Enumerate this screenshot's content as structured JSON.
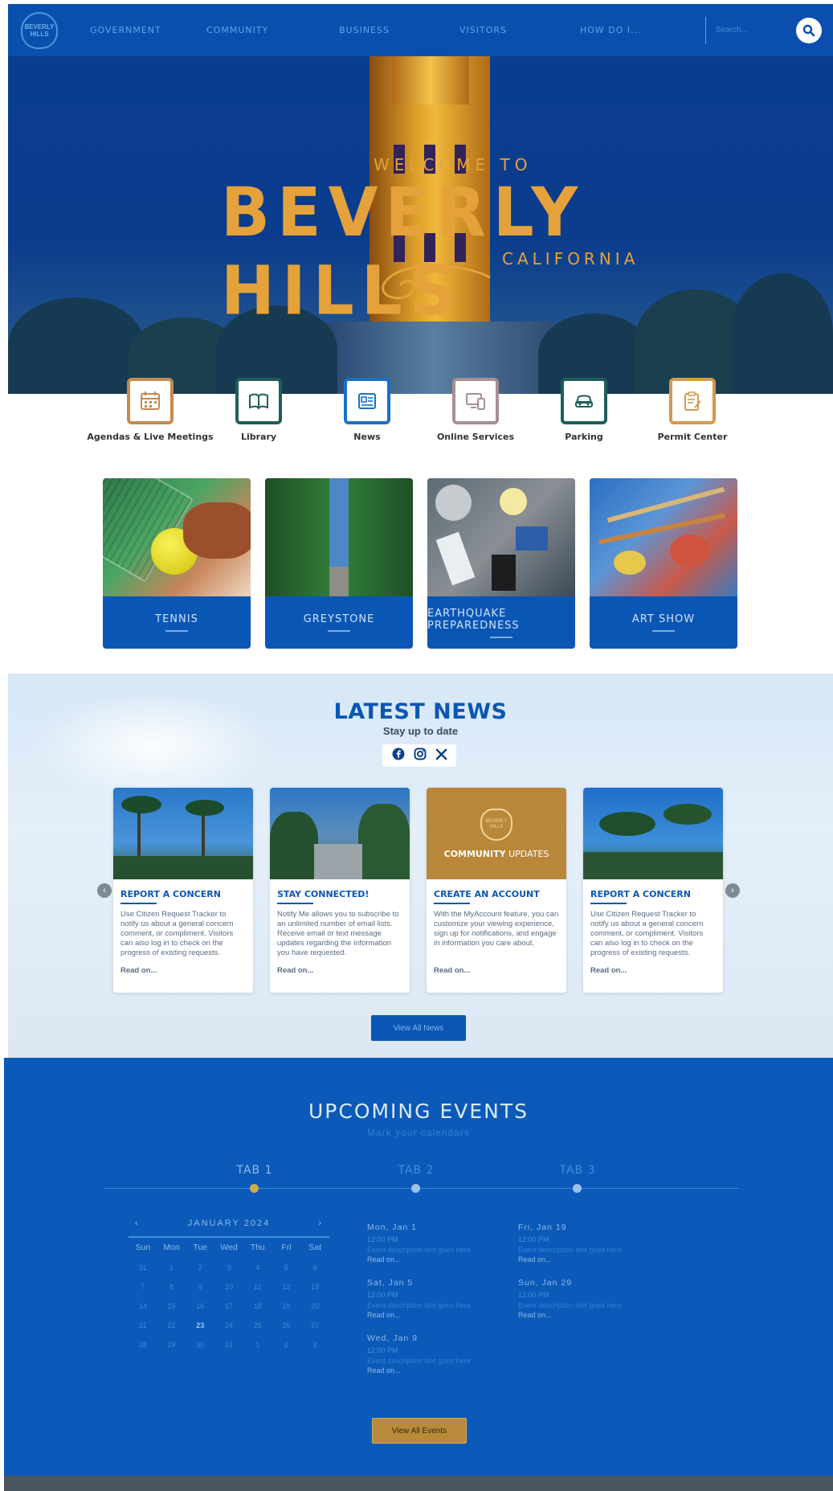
{
  "nav": {
    "logo_text": "BEVERLY HILLS",
    "links": [
      "GOVERNMENT",
      "COMMUNITY",
      "BUSINESS",
      "VISITORS",
      "HOW DO I..."
    ],
    "search_label": "Search...",
    "search_icon": "search-icon"
  },
  "hero": {
    "welcome": "WELCOME TO",
    "title": "BEVERLY HILLS",
    "subtitle": "CALIFORNIA"
  },
  "quick_links": [
    {
      "label": "Agendas & Live Meetings",
      "icon": "calendar-icon",
      "color": "#c28b4f"
    },
    {
      "label": "Library",
      "icon": "book-icon",
      "color": "#1e5f5a"
    },
    {
      "label": "News",
      "icon": "newspaper-icon",
      "color": "#1a70c8"
    },
    {
      "label": "Online Services",
      "icon": "devices-icon",
      "color": "#a88f93"
    },
    {
      "label": "Parking",
      "icon": "car-icon",
      "color": "#1e5f5a"
    },
    {
      "label": "Permit Center",
      "icon": "clipboard-icon",
      "color": "#d59a4c"
    }
  ],
  "features": [
    {
      "label": "TENNIS"
    },
    {
      "label": "GREYSTONE"
    },
    {
      "label": "EARTHQUAKE PREPAREDNESS"
    },
    {
      "label": "ART SHOW"
    }
  ],
  "news": {
    "title": "LATEST NEWS",
    "subtitle": "Stay up to date",
    "social": [
      "facebook-icon",
      "instagram-icon",
      "x-icon"
    ],
    "promo_badge": "BEVERLY HILLS",
    "promo_text_bold": "COMMUNITY",
    "promo_text": "UPDATES",
    "cards": [
      {
        "title": "REPORT A CONCERN",
        "text": "Use Citizen Request Tracker to notify us about a general concern comment, or compliment. Visitors can also log in to check on the progress of existing requests.",
        "read": "Read on..."
      },
      {
        "title": "STAY CONNECTED!",
        "text": "Notify Me allows you to subscribe to an unlimited number of email lists. Receive email or text message updates regarding the information you have requested.",
        "read": "Read on..."
      },
      {
        "title": "CREATE AN ACCOUNT",
        "text": "With the MyAccount feature, you can customize your viewing experience, sign up for notifications, and engage in information you care about.",
        "read": "Read on..."
      },
      {
        "title": "REPORT A CONCERN",
        "text": "Use Citizen Request Tracker to notify us about a general concern comment, or compliment. Visitors can also log in to check on the progress of existing requests.",
        "read": "Read on..."
      }
    ],
    "view_all": "View All News"
  },
  "events": {
    "title": "UPCOMING EVENTS",
    "subtitle": "Mark your calendars",
    "tabs": [
      "TAB 1",
      "TAB 2",
      "TAB 3"
    ],
    "calendar": {
      "month": "JANUARY 2024",
      "prev": "‹",
      "next": "›",
      "days": [
        "Sun",
        "Mon",
        "Tue",
        "Wed",
        "Thu",
        "Fri",
        "Sat"
      ],
      "dates": [
        "31",
        "1",
        "2",
        "3",
        "4",
        "5",
        "6",
        "7",
        "8",
        "9",
        "10",
        "11",
        "12",
        "13",
        "14",
        "15",
        "16",
        "17",
        "18",
        "19",
        "20",
        "21",
        "22",
        "23",
        "24",
        "25",
        "26",
        "27",
        "28",
        "29",
        "30",
        "31",
        "1",
        "2",
        "3"
      ]
    },
    "col1": [
      {
        "date": "Mon, Jan 1",
        "time": "12:00 PM",
        "desc": "Event description text goes here",
        "read": "Read on..."
      },
      {
        "date": "Sat, Jan 5",
        "time": "12:00 PM",
        "desc": "Event description text goes here",
        "read": "Read on..."
      },
      {
        "date": "Wed, Jan 9",
        "time": "12:00 PM",
        "desc": "Event description text goes here",
        "read": "Read on..."
      }
    ],
    "col2": [
      {
        "date": "Fri, Jan 19",
        "time": "12:00 PM",
        "desc": "Event description text goes here",
        "read": "Read on..."
      },
      {
        "date": "Sun, Jan 29",
        "time": "12:00 PM",
        "desc": "Event description text goes here",
        "read": "Read on..."
      }
    ],
    "view_all": "View All Events"
  }
}
